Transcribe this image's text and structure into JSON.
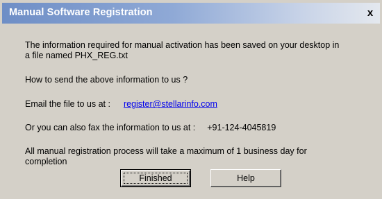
{
  "window": {
    "title": "Manual Software Registration",
    "close_label": "x"
  },
  "message": {
    "line1": "The information required for manual activation has been saved on your desktop in",
    "line2": "a file named PHX_REG.txt",
    "question": "How to send the above information to us ?",
    "email_prefix": "Email the file  to us at :",
    "email_link": "register@stellarinfo.com",
    "fax_prefix": "Or you can also fax the information  to us at :",
    "fax_number": "+91-124-4045819",
    "notice_line1": "All manual registration process will take a maximum of 1 business day for",
    "notice_line2": "completion"
  },
  "buttons": {
    "finished": "Finished",
    "help": "Help"
  }
}
